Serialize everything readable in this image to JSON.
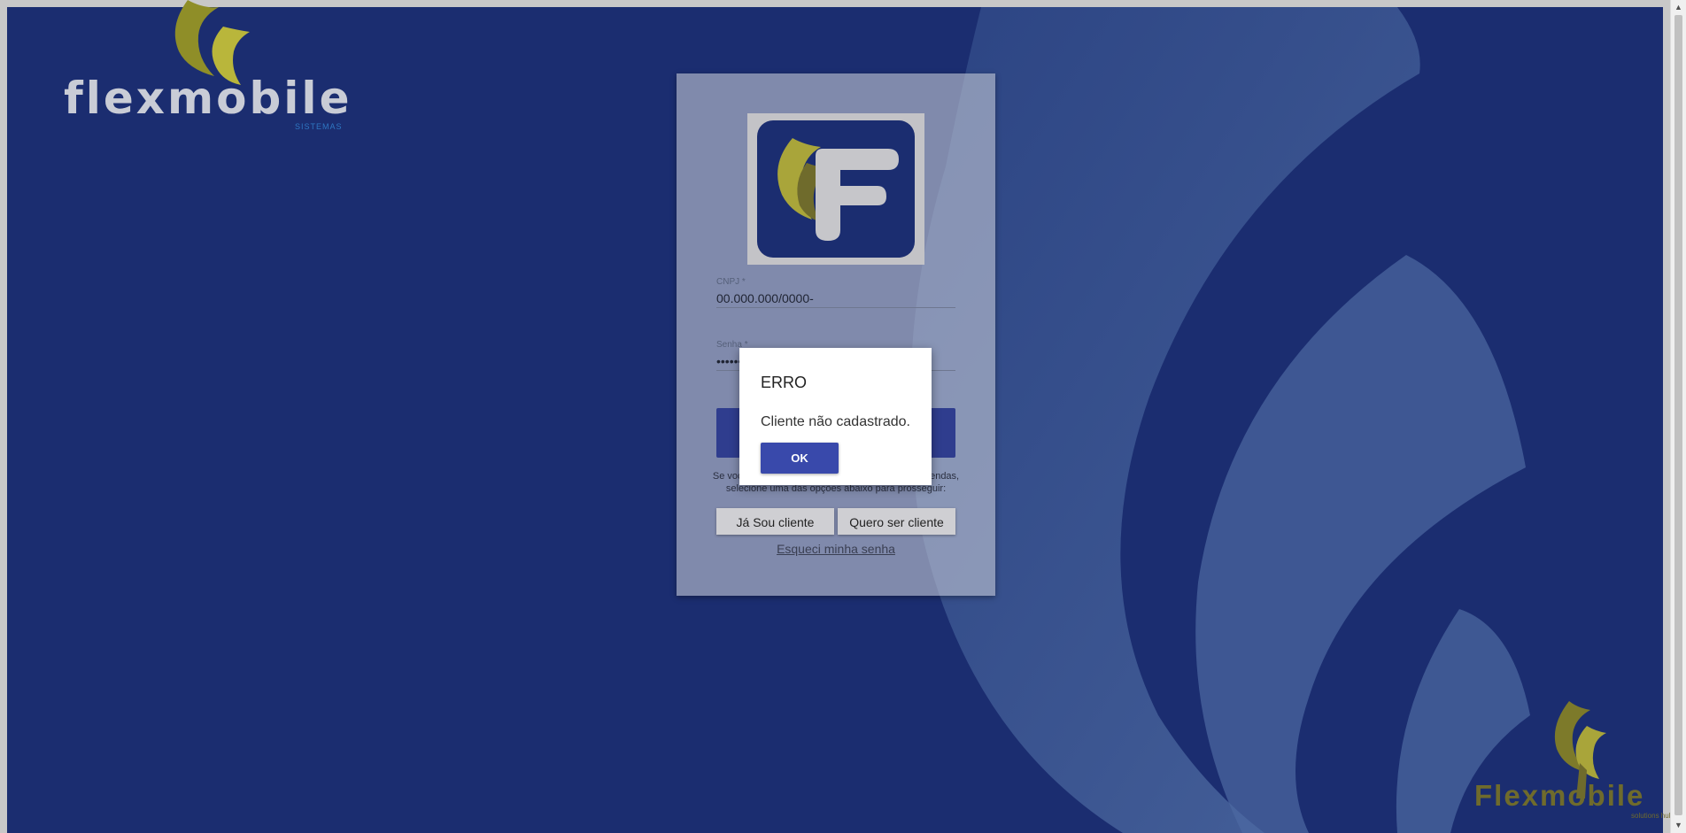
{
  "brand": {
    "name": "flexmobile",
    "subtitle": "SISTEMAS"
  },
  "corner_brand": {
    "name": "Flexmobile",
    "subtitle": "solutions hub"
  },
  "login": {
    "cnpj_label": "CNPJ *",
    "cnpj_value": "00.000.000/0000-",
    "senha_label": "Senha *",
    "senha_value": "••••••",
    "info_text": "Se você ainda não possui acesso ao Flexmobile Vendas, selecione uma das opções abaixo para prosseguir:",
    "ja_sou_cliente": "Já Sou cliente",
    "quero_ser_cliente": "Quero ser cliente",
    "forgot_password": "Esqueci minha senha"
  },
  "dialog": {
    "title": "ERRO",
    "message": "Cliente não cadastrado.",
    "ok_label": "OK"
  },
  "colors": {
    "background": "#1b2d70",
    "accent": "#3949ab",
    "leaf_gold": "#b7b43a"
  },
  "icons": [
    "flexmobile-leaf-icon",
    "flexmobile-f-logo-icon",
    "scroll-up-icon",
    "scroll-down-icon"
  ]
}
